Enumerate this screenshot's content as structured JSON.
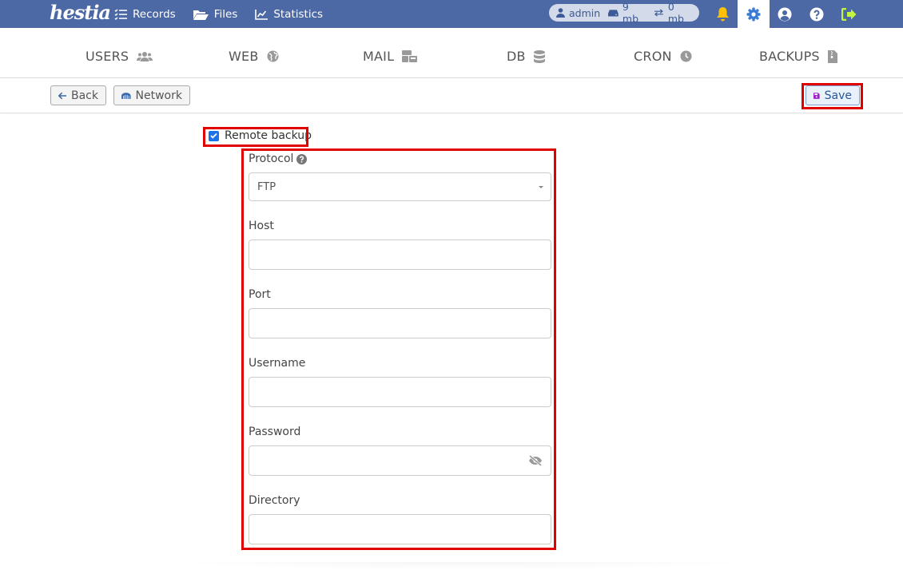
{
  "app": {
    "logo_text": "hestia"
  },
  "topnav": {
    "items": [
      {
        "label": "Records",
        "icon": "list-check-icon"
      },
      {
        "label": "Files",
        "icon": "folder-open-icon"
      },
      {
        "label": "Statistics",
        "icon": "chart-line-icon"
      }
    ],
    "stats": {
      "user": "admin",
      "disk": "9 mb",
      "bandwidth": "0 mb"
    },
    "icons": [
      "bell-icon",
      "gear-icon",
      "user-circle-icon",
      "question-circle-icon",
      "sign-out-icon"
    ],
    "colors": {
      "bar": "#4c69a5",
      "bell": "#ffc107",
      "gear_active": "#3a7bd5",
      "logout": "#c2f542"
    }
  },
  "tabs": [
    {
      "label": "USERS",
      "icon": "users-icon"
    },
    {
      "label": "WEB",
      "icon": "globe-icon"
    },
    {
      "label": "MAIL",
      "icon": "mail-bulk-icon"
    },
    {
      "label": "DB",
      "icon": "database-icon"
    },
    {
      "label": "CRON",
      "icon": "clock-icon"
    },
    {
      "label": "BACKUPS",
      "icon": "file-archive-icon"
    }
  ],
  "toolbar": {
    "back_label": "Back",
    "network_label": "Network",
    "save_label": "Save"
  },
  "form": {
    "remote_backup_label": "Remote backup",
    "remote_backup_checked": true,
    "protocol_label": "Protocol",
    "protocol_value": "FTP",
    "host_label": "Host",
    "host_value": "",
    "port_label": "Port",
    "port_value": "",
    "username_label": "Username",
    "username_value": "",
    "password_label": "Password",
    "password_value": "",
    "directory_label": "Directory",
    "directory_value": ""
  }
}
